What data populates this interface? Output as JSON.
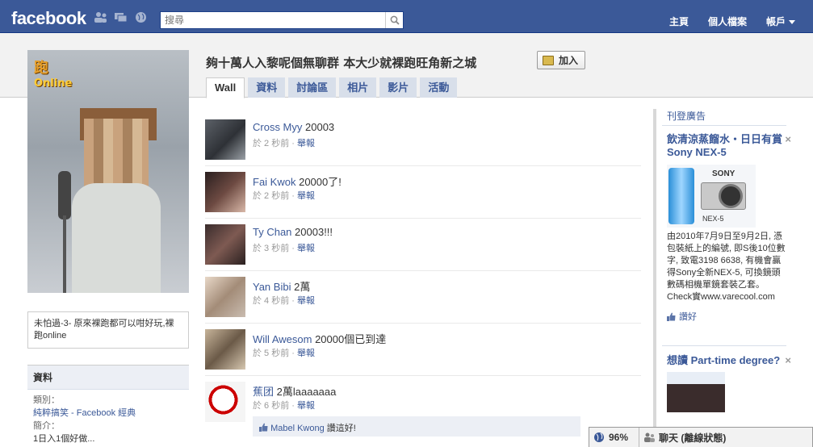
{
  "topbar": {
    "logo": "facebook",
    "search_placeholder": "搜尋",
    "nav": [
      "主頁",
      "個人檔案",
      "帳戶"
    ]
  },
  "profile": {
    "bio": "未怕過-3- 原來裸跑都可以咁好玩,裸跑online",
    "game_logo": "跑",
    "game_logo_sub": "Online"
  },
  "info": {
    "title": "資料",
    "category_label": "類別：",
    "category_value": "純粹搞笑 - Facebook 經典",
    "intro_label": "簡介：",
    "intro_value": "1日入1個好做..."
  },
  "page": {
    "title": "夠十萬人入黎呢個無聊群 本大少就裸跑旺角新之城",
    "join_label": "加入",
    "tabs": [
      "Wall",
      "資料",
      "討論區",
      "相片",
      "影片",
      "活動"
    ]
  },
  "stories": [
    {
      "name": "Cross Myy",
      "text": "20003",
      "time": "於 2 秒前",
      "report": "舉報"
    },
    {
      "name": "Fai Kwok",
      "text": "20000了!",
      "time": "於 2 秒前",
      "report": "舉報"
    },
    {
      "name": "Ty Chan",
      "text": "20003!!!",
      "time": "於 3 秒前",
      "report": "舉報"
    },
    {
      "name": "Yan Bibi",
      "text": "2萬",
      "time": "於 4 秒前",
      "report": "舉報"
    },
    {
      "name": "Will Awesom",
      "text": "20000個已到達",
      "time": "於 5 秒前",
      "report": "舉報"
    },
    {
      "name": "蕉团",
      "text": "2萬laaaaaaa",
      "time": "於 6 秒前",
      "report": "舉報"
    }
  ],
  "likebar": {
    "liker": "Mabel Kwong",
    "text": "讚這好!"
  },
  "ads": {
    "label": "刊登廣告",
    "ad1": {
      "title": "飲清涼蒸餾水・日日有賞Sony NEX-5",
      "body": "由2010年7月9日至9月2日, 憑包裝紙上的編號, 即S後10位數字, 致電3198 6638, 有機會贏得Sony全新NEX-5, 可換鏡頭數碼相機單鏡套裝乙套。Check實www.varecool.com",
      "like": "讚好",
      "img_brand": "SONY",
      "img_model": "NEX-5"
    },
    "ad2": {
      "title": "想讀 Part-time degree?"
    }
  },
  "chat": {
    "percent": "96%",
    "status": "聊天 (離線狀態)"
  }
}
